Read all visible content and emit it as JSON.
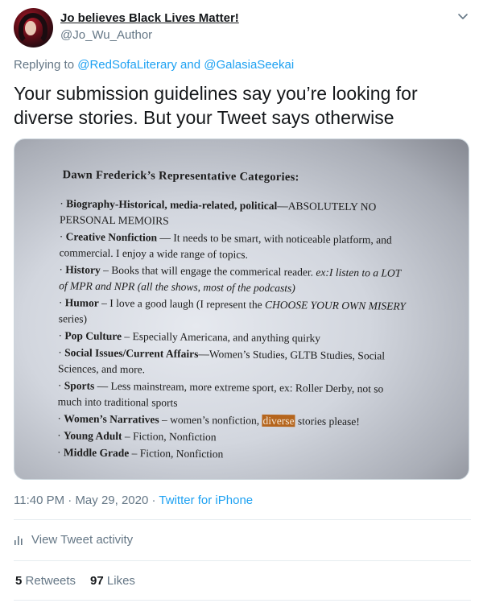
{
  "author": {
    "display_name": "Jo believes Black Lives Matter!",
    "handle": "@Jo_Wu_Author",
    "avatar_icon": "profile-photo"
  },
  "reply": {
    "prefix": "Replying to",
    "mention1": "@RedSofaLiterary",
    "and": "and",
    "mention2": "@GalasiaSeekai"
  },
  "tweet": {
    "text": "Your submission guidelines say you’re looking for diverse stories. But your Tweet says otherwise"
  },
  "image": {
    "title": "Dawn Frederick’s Representative Categories:",
    "highlight_color": "#b5651d",
    "items": [
      {
        "label": "Biography-Historical, media-related, political",
        "line1_rest": "—ABSOLUTELY NO",
        "line2": "PERSONAL MEMOIRS"
      },
      {
        "label": "Creative Nonfiction",
        "line1_rest": " — It needs to be smart, with noticeable platform, and",
        "line2": "commercial. I enjoy a wide range of topics."
      },
      {
        "label": "History",
        "line1_rest": " – Books that will engage the commerical reader.  ",
        "line1_italic": "ex:I listen to a LOT",
        "line2": "of MPR and NPR (all the shows, most of the podcasts)"
      },
      {
        "label": "Humor",
        "line1_rest": " – I love a good laugh (I represent the ",
        "line1_italic": "CHOOSE YOUR OWN MISERY",
        "line2": "series)"
      },
      {
        "label": "Pop Culture",
        "line1_rest": " – Especially Americana, and anything quirky"
      },
      {
        "label": "Social Issues/Current Affairs",
        "line1_rest": "—Women’s Studies, GLTB Studies, Social",
        "line2": "Sciences, and more."
      },
      {
        "label": "Sports",
        "line1_rest": " — Less mainstream, more extreme sport, ex: Roller Derby, not so",
        "line2": "much into traditional sports"
      },
      {
        "label": "Women’s Narratives",
        "line1_rest": " – women’s nonfiction, ",
        "highlight": "diverse",
        "line1_after": " stories please!"
      },
      {
        "label": "Young Adult",
        "line1_rest": " – Fiction, Nonfiction"
      },
      {
        "label": "Middle Grade",
        "line1_rest": " – Fiction, Nonfiction"
      }
    ]
  },
  "meta": {
    "time": "11:40 PM",
    "dot1": "·",
    "date": "May 29, 2020",
    "dot2": "·",
    "source": "Twitter for iPhone"
  },
  "activity": {
    "label": "View Tweet activity",
    "icon": "bar-chart-icon"
  },
  "stats": {
    "retweets_count": "5",
    "retweets_label": "Retweets",
    "likes_count": "97",
    "likes_label": "Likes"
  },
  "colors": {
    "link": "#1da1f2",
    "muted": "#657786",
    "text": "#14171a"
  }
}
